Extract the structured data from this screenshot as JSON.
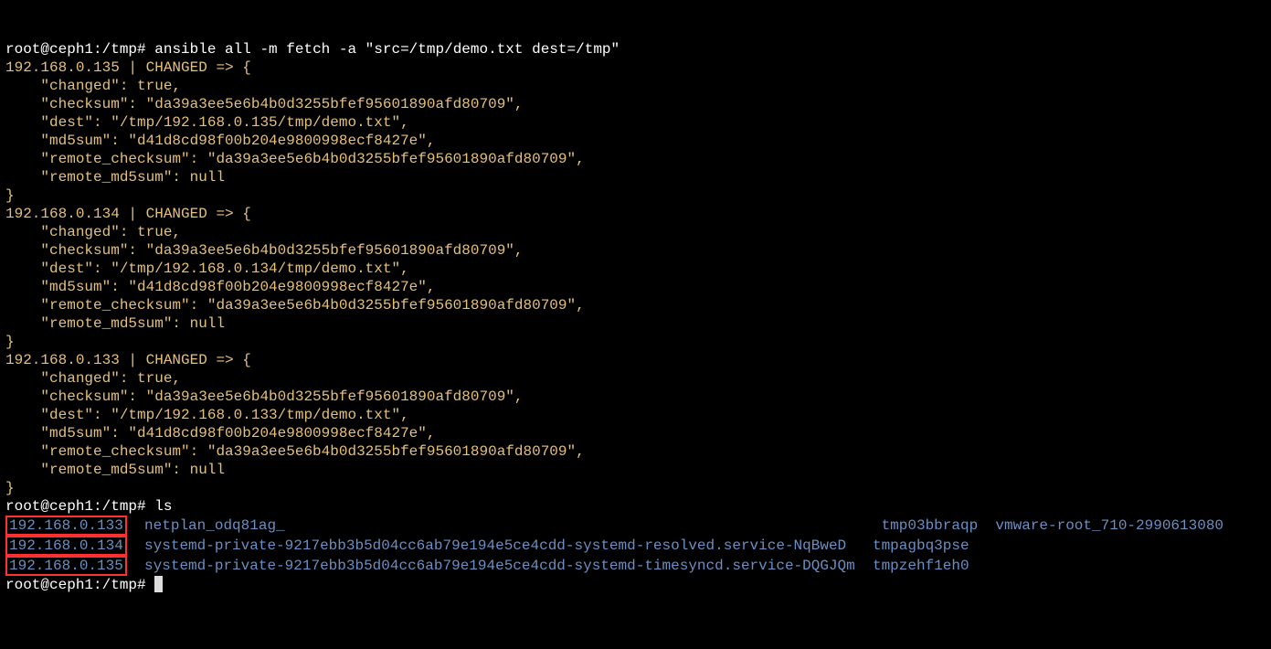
{
  "prompt1": {
    "prefix": "root@ceph1:/tmp# ",
    "command": "ansible all -m fetch -a \"src=/tmp/demo.txt dest=/tmp\""
  },
  "hosts": [
    {
      "header": "192.168.0.135 | CHANGED => {",
      "lines": [
        "    \"changed\": true,",
        "    \"checksum\": \"da39a3ee5e6b4b0d3255bfef95601890afd80709\",",
        "    \"dest\": \"/tmp/192.168.0.135/tmp/demo.txt\",",
        "    \"md5sum\": \"d41d8cd98f00b204e9800998ecf8427e\",",
        "    \"remote_checksum\": \"da39a3ee5e6b4b0d3255bfef95601890afd80709\",",
        "    \"remote_md5sum\": null",
        "}"
      ]
    },
    {
      "header": "192.168.0.134 | CHANGED => {",
      "lines": [
        "    \"changed\": true,",
        "    \"checksum\": \"da39a3ee5e6b4b0d3255bfef95601890afd80709\",",
        "    \"dest\": \"/tmp/192.168.0.134/tmp/demo.txt\",",
        "    \"md5sum\": \"d41d8cd98f00b204e9800998ecf8427e\",",
        "    \"remote_checksum\": \"da39a3ee5e6b4b0d3255bfef95601890afd80709\",",
        "    \"remote_md5sum\": null",
        "}"
      ]
    },
    {
      "header": "192.168.0.133 | CHANGED => {",
      "lines": [
        "    \"changed\": true,",
        "    \"checksum\": \"da39a3ee5e6b4b0d3255bfef95601890afd80709\",",
        "    \"dest\": \"/tmp/192.168.0.133/tmp/demo.txt\",",
        "    \"md5sum\": \"d41d8cd98f00b204e9800998ecf8427e\",",
        "    \"remote_checksum\": \"da39a3ee5e6b4b0d3255bfef95601890afd80709\",",
        "    \"remote_md5sum\": null",
        "}"
      ]
    }
  ],
  "prompt2": {
    "prefix": "root@ceph1:/tmp# ",
    "command": "ls"
  },
  "ls": {
    "row1": {
      "dir": "192.168.0.133",
      "c2": "netplan_odq81ag_",
      "c3": "tmp03bbraqp",
      "c4": "vmware-root_710-2990613080"
    },
    "row2": {
      "dir": "192.168.0.134",
      "c2": "systemd-private-9217ebb3b5d04cc6ab79e194e5ce4cdd-systemd-resolved.service-NqBweD",
      "c3": "tmpagbq3pse",
      "c4": ""
    },
    "row3": {
      "dir": "192.168.0.135",
      "c2": "systemd-private-9217ebb3b5d04cc6ab79e194e5ce4cdd-systemd-timesyncd.service-DQGJQm",
      "c3": "tmpzehf1eh0",
      "c4": ""
    }
  },
  "prompt3": {
    "prefix": "root@ceph1:/tmp# "
  },
  "colors": {
    "bg": "#000000",
    "fg": "#ffffff",
    "yellow": "#e5c07b",
    "blue": "#6a8fc4",
    "highlight_border": "#ff3030"
  }
}
